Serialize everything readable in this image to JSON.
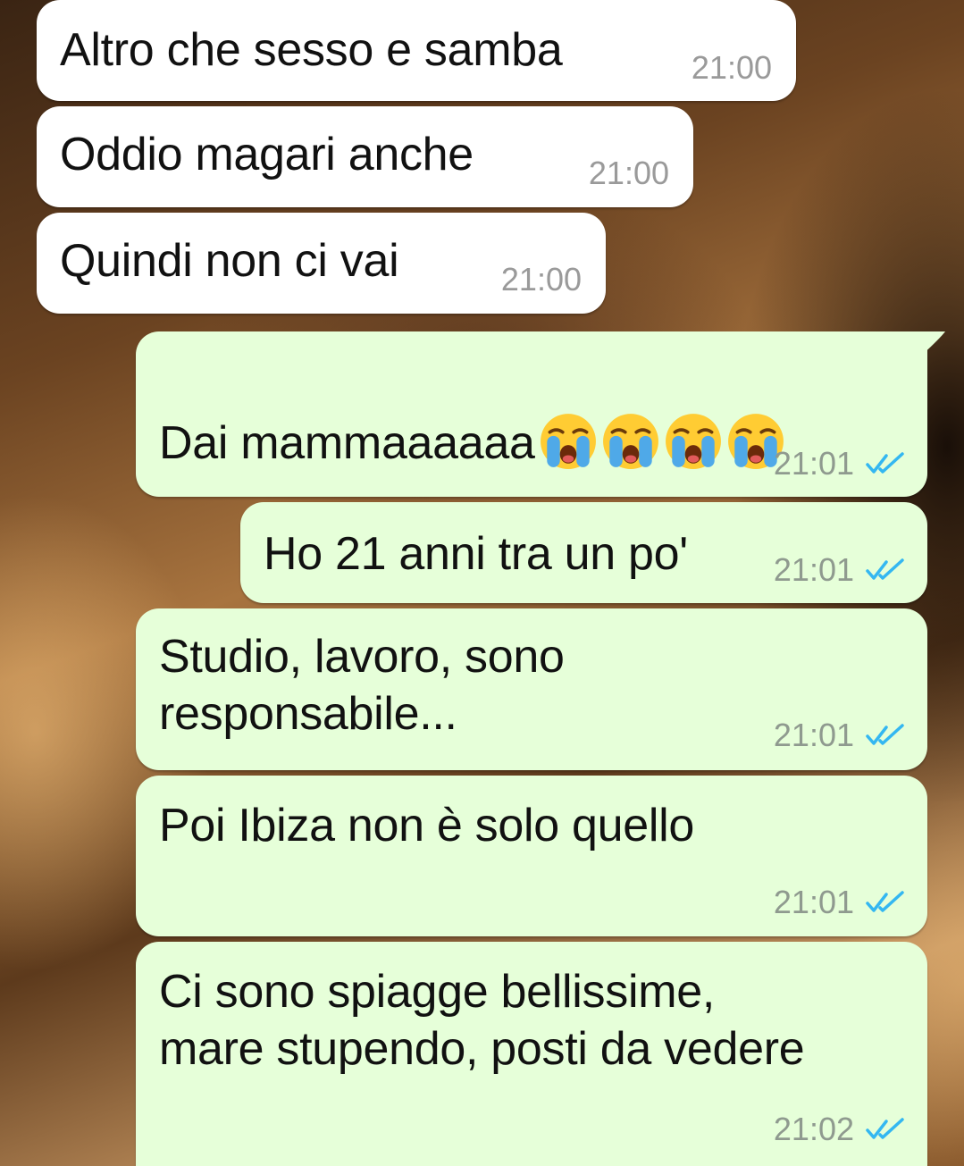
{
  "colors": {
    "incoming_bubble": "#ffffff",
    "outgoing_bubble": "#e6ffd9",
    "read_ticks": "#34b7f1",
    "timestamp": "#8f9a8f"
  },
  "messages": [
    {
      "direction": "incoming",
      "text": "Altro che sesso e samba",
      "time": "21:00"
    },
    {
      "direction": "incoming",
      "text": "Oddio magari anche",
      "time": "21:00"
    },
    {
      "direction": "incoming",
      "text": "Quindi non ci vai",
      "time": "21:00"
    },
    {
      "direction": "outgoing",
      "text": "Dai mammaaaaaa",
      "emojis": [
        "loudly-crying-face-icon",
        "loudly-crying-face-icon",
        "loudly-crying-face-icon",
        "loudly-crying-face-icon"
      ],
      "time": "21:01",
      "status": "read"
    },
    {
      "direction": "outgoing",
      "text": "Ho 21 anni tra un po'",
      "time": "21:01",
      "status": "read"
    },
    {
      "direction": "outgoing",
      "text": "Studio, lavoro, sono\nresponsabile...",
      "time": "21:01",
      "status": "read"
    },
    {
      "direction": "outgoing",
      "text": "Poi Ibiza non è solo quello",
      "time": "21:01",
      "status": "read"
    },
    {
      "direction": "outgoing",
      "text": "Ci sono spiagge bellissime,\nmare stupendo, posti da vedere",
      "time": "21:02",
      "status": "read"
    }
  ]
}
